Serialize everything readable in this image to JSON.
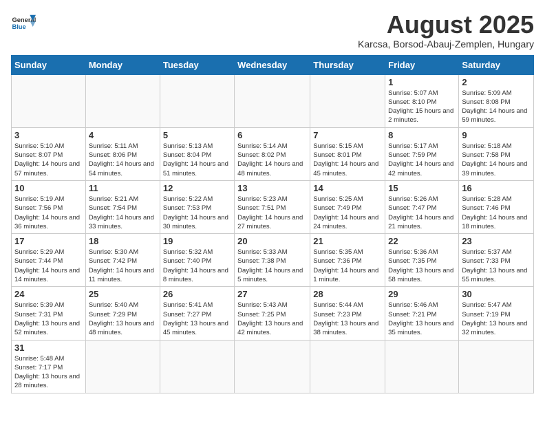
{
  "logo": {
    "general": "General",
    "blue": "Blue"
  },
  "header": {
    "month": "August 2025",
    "location": "Karcsa, Borsod-Abauj-Zemplen, Hungary"
  },
  "days_of_week": [
    "Sunday",
    "Monday",
    "Tuesday",
    "Wednesday",
    "Thursday",
    "Friday",
    "Saturday"
  ],
  "weeks": [
    [
      {
        "day": null,
        "info": null
      },
      {
        "day": null,
        "info": null
      },
      {
        "day": null,
        "info": null
      },
      {
        "day": null,
        "info": null
      },
      {
        "day": null,
        "info": null
      },
      {
        "day": "1",
        "info": "Sunrise: 5:07 AM\nSunset: 8:10 PM\nDaylight: 15 hours and 2 minutes."
      },
      {
        "day": "2",
        "info": "Sunrise: 5:09 AM\nSunset: 8:08 PM\nDaylight: 14 hours and 59 minutes."
      }
    ],
    [
      {
        "day": "3",
        "info": "Sunrise: 5:10 AM\nSunset: 8:07 PM\nDaylight: 14 hours and 57 minutes."
      },
      {
        "day": "4",
        "info": "Sunrise: 5:11 AM\nSunset: 8:06 PM\nDaylight: 14 hours and 54 minutes."
      },
      {
        "day": "5",
        "info": "Sunrise: 5:13 AM\nSunset: 8:04 PM\nDaylight: 14 hours and 51 minutes."
      },
      {
        "day": "6",
        "info": "Sunrise: 5:14 AM\nSunset: 8:02 PM\nDaylight: 14 hours and 48 minutes."
      },
      {
        "day": "7",
        "info": "Sunrise: 5:15 AM\nSunset: 8:01 PM\nDaylight: 14 hours and 45 minutes."
      },
      {
        "day": "8",
        "info": "Sunrise: 5:17 AM\nSunset: 7:59 PM\nDaylight: 14 hours and 42 minutes."
      },
      {
        "day": "9",
        "info": "Sunrise: 5:18 AM\nSunset: 7:58 PM\nDaylight: 14 hours and 39 minutes."
      }
    ],
    [
      {
        "day": "10",
        "info": "Sunrise: 5:19 AM\nSunset: 7:56 PM\nDaylight: 14 hours and 36 minutes."
      },
      {
        "day": "11",
        "info": "Sunrise: 5:21 AM\nSunset: 7:54 PM\nDaylight: 14 hours and 33 minutes."
      },
      {
        "day": "12",
        "info": "Sunrise: 5:22 AM\nSunset: 7:53 PM\nDaylight: 14 hours and 30 minutes."
      },
      {
        "day": "13",
        "info": "Sunrise: 5:23 AM\nSunset: 7:51 PM\nDaylight: 14 hours and 27 minutes."
      },
      {
        "day": "14",
        "info": "Sunrise: 5:25 AM\nSunset: 7:49 PM\nDaylight: 14 hours and 24 minutes."
      },
      {
        "day": "15",
        "info": "Sunrise: 5:26 AM\nSunset: 7:47 PM\nDaylight: 14 hours and 21 minutes."
      },
      {
        "day": "16",
        "info": "Sunrise: 5:28 AM\nSunset: 7:46 PM\nDaylight: 14 hours and 18 minutes."
      }
    ],
    [
      {
        "day": "17",
        "info": "Sunrise: 5:29 AM\nSunset: 7:44 PM\nDaylight: 14 hours and 14 minutes."
      },
      {
        "day": "18",
        "info": "Sunrise: 5:30 AM\nSunset: 7:42 PM\nDaylight: 14 hours and 11 minutes."
      },
      {
        "day": "19",
        "info": "Sunrise: 5:32 AM\nSunset: 7:40 PM\nDaylight: 14 hours and 8 minutes."
      },
      {
        "day": "20",
        "info": "Sunrise: 5:33 AM\nSunset: 7:38 PM\nDaylight: 14 hours and 5 minutes."
      },
      {
        "day": "21",
        "info": "Sunrise: 5:35 AM\nSunset: 7:36 PM\nDaylight: 14 hours and 1 minute."
      },
      {
        "day": "22",
        "info": "Sunrise: 5:36 AM\nSunset: 7:35 PM\nDaylight: 13 hours and 58 minutes."
      },
      {
        "day": "23",
        "info": "Sunrise: 5:37 AM\nSunset: 7:33 PM\nDaylight: 13 hours and 55 minutes."
      }
    ],
    [
      {
        "day": "24",
        "info": "Sunrise: 5:39 AM\nSunset: 7:31 PM\nDaylight: 13 hours and 52 minutes."
      },
      {
        "day": "25",
        "info": "Sunrise: 5:40 AM\nSunset: 7:29 PM\nDaylight: 13 hours and 48 minutes."
      },
      {
        "day": "26",
        "info": "Sunrise: 5:41 AM\nSunset: 7:27 PM\nDaylight: 13 hours and 45 minutes."
      },
      {
        "day": "27",
        "info": "Sunrise: 5:43 AM\nSunset: 7:25 PM\nDaylight: 13 hours and 42 minutes."
      },
      {
        "day": "28",
        "info": "Sunrise: 5:44 AM\nSunset: 7:23 PM\nDaylight: 13 hours and 38 minutes."
      },
      {
        "day": "29",
        "info": "Sunrise: 5:46 AM\nSunset: 7:21 PM\nDaylight: 13 hours and 35 minutes."
      },
      {
        "day": "30",
        "info": "Sunrise: 5:47 AM\nSunset: 7:19 PM\nDaylight: 13 hours and 32 minutes."
      }
    ],
    [
      {
        "day": "31",
        "info": "Sunrise: 5:48 AM\nSunset: 7:17 PM\nDaylight: 13 hours and 28 minutes."
      },
      {
        "day": null,
        "info": null
      },
      {
        "day": null,
        "info": null
      },
      {
        "day": null,
        "info": null
      },
      {
        "day": null,
        "info": null
      },
      {
        "day": null,
        "info": null
      },
      {
        "day": null,
        "info": null
      }
    ]
  ]
}
